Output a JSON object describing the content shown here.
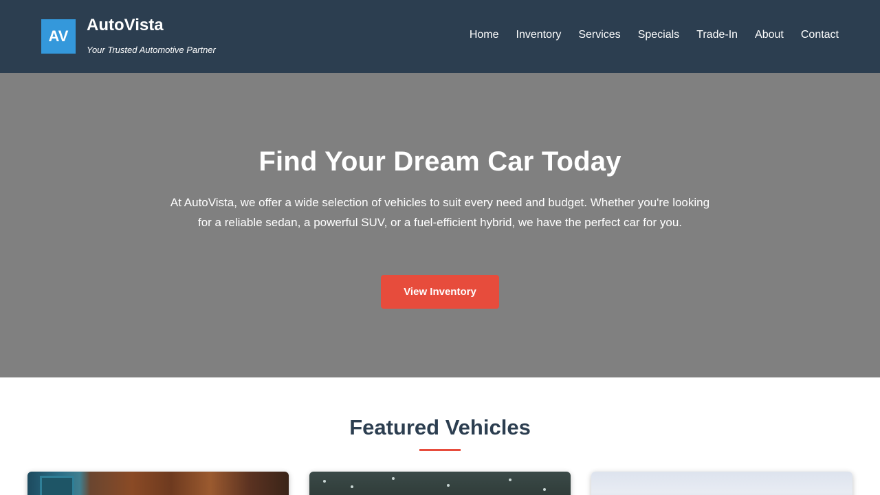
{
  "brand": {
    "logo_text": "AV",
    "name": "AutoVista",
    "tagline": "Your Trusted Automotive Partner"
  },
  "nav": {
    "items": [
      "Home",
      "Inventory",
      "Services",
      "Specials",
      "Trade-In",
      "About",
      "Contact"
    ]
  },
  "hero": {
    "title": "Find Your Dream Car Today",
    "description": "At AutoVista, we offer a wide selection of vehicles to suit every need and budget. Whether you're looking for a reliable sedan, a powerful SUV, or a fuel-efficient hybrid, we have the perfect car for you.",
    "button_label": "View Inventory"
  },
  "featured": {
    "title": "Featured Vehicles"
  },
  "colors": {
    "header_bg": "#2c3e50",
    "logo_bg": "#3498db",
    "accent": "#e74c3c",
    "hero_bg": "#808080"
  }
}
